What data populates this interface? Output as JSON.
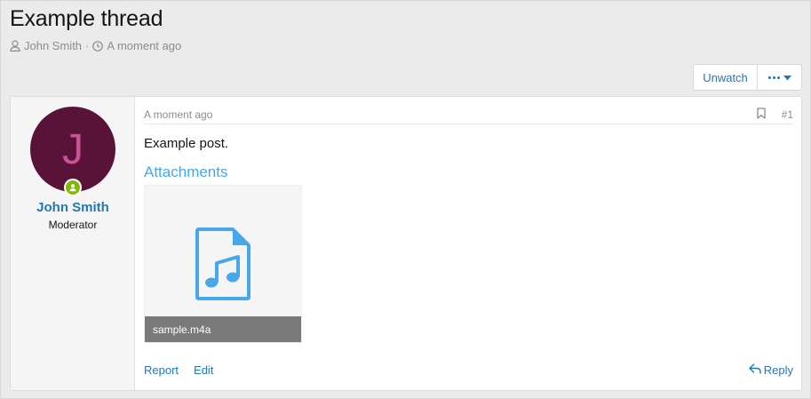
{
  "thread": {
    "title": "Example thread",
    "author": "John Smith",
    "separator": "·",
    "time": "A moment ago"
  },
  "actions": {
    "unwatch_label": "Unwatch"
  },
  "post": {
    "user": {
      "avatar_letter": "J",
      "name": "John Smith",
      "title": "Moderator"
    },
    "date": "A moment ago",
    "number": "#1",
    "body": "Example post.",
    "attachments_title": "Attachments",
    "attachment": {
      "filename": "sample.m4a",
      "icon": "audio-file-icon"
    },
    "footer": {
      "report_label": "Report",
      "edit_label": "Edit",
      "reply_label": "Reply"
    }
  },
  "colors": {
    "link": "#2577b1",
    "accent": "#47a7eb",
    "avatar_bg": "#5a1338",
    "avatar_letter": "#c85497",
    "online": "#7fb900"
  }
}
